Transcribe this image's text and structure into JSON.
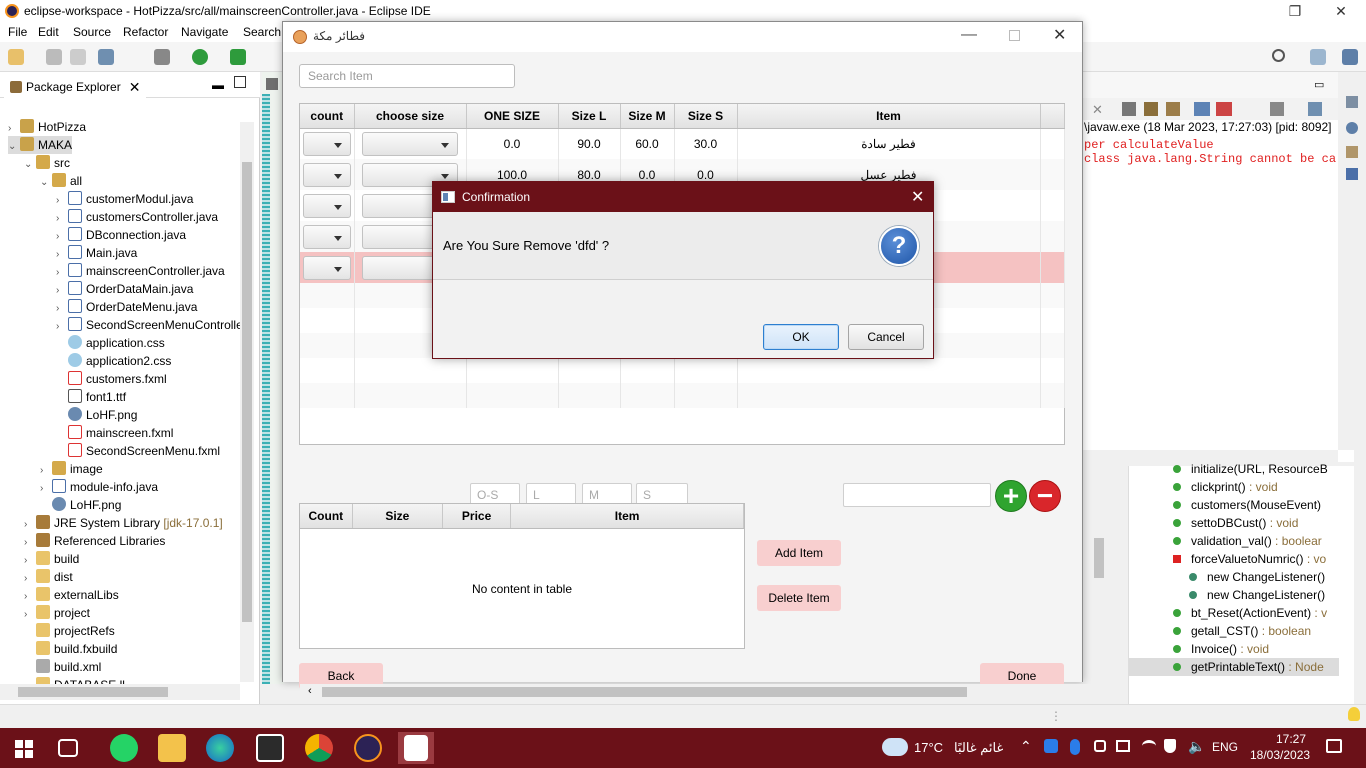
{
  "eclipse": {
    "title": "eclipse-workspace - HotPizza/src/all/mainscreenController.java - Eclipse IDE",
    "menu": [
      "File",
      "Edit",
      "Source",
      "Refactor",
      "Navigate",
      "Search"
    ],
    "package_explorer": {
      "tab": "Package Explorer",
      "items": [
        {
          "label": "HotPizza",
          "icon": "project-icon"
        },
        {
          "label": "MAKA",
          "icon": "project-icon"
        },
        {
          "label": "src",
          "icon": "package-folder-icon"
        },
        {
          "label": "all",
          "icon": "package-icon"
        },
        {
          "label": "customerModul.java",
          "icon": "java-file-icon"
        },
        {
          "label": "customersController.java",
          "icon": "java-file-icon"
        },
        {
          "label": "DBconnection.java",
          "icon": "java-file-icon"
        },
        {
          "label": "Main.java",
          "icon": "java-file-icon"
        },
        {
          "label": "mainscreenController.java",
          "icon": "java-file-icon"
        },
        {
          "label": "OrderDataMain.java",
          "icon": "java-file-icon"
        },
        {
          "label": "OrderDateMenu.java",
          "icon": "java-file-icon"
        },
        {
          "label": "SecondScreenMenuControlle",
          "icon": "java-file-icon"
        },
        {
          "label": "application.css",
          "icon": "css-file-icon"
        },
        {
          "label": "application2.css",
          "icon": "css-file-icon"
        },
        {
          "label": "customers.fxml",
          "icon": "fxml-file-icon"
        },
        {
          "label": "font1.ttf",
          "icon": "font-file-icon"
        },
        {
          "label": "LoHF.png",
          "icon": "image-file-icon"
        },
        {
          "label": "mainscreen.fxml",
          "icon": "fxml-file-icon"
        },
        {
          "label": "SecondScreenMenu.fxml",
          "icon": "fxml-file-icon"
        },
        {
          "label": "image",
          "icon": "package-icon"
        },
        {
          "label": "module-info.java",
          "icon": "java-file-icon"
        },
        {
          "label": "LoHF.png",
          "icon": "image-file-icon"
        },
        {
          "label": "JRE System Library",
          "suffix": "[jdk-17.0.1]",
          "icon": "library-icon"
        },
        {
          "label": "Referenced Libraries",
          "icon": "library-icon"
        },
        {
          "label": "build",
          "icon": "folder-icon"
        },
        {
          "label": "dist",
          "icon": "folder-icon"
        },
        {
          "label": "externalLibs",
          "icon": "folder-icon"
        },
        {
          "label": "project",
          "icon": "folder-icon"
        },
        {
          "label": "projectRefs",
          "icon": "folder-icon"
        },
        {
          "label": "build.fxbuild",
          "icon": "file-icon"
        },
        {
          "label": "build.xml",
          "icon": "xml-file-icon"
        },
        {
          "label": "DATABASE.ll",
          "icon": "file-icon"
        }
      ]
    },
    "console": {
      "header": "\\javaw.exe  (18 Mar 2023, 17:27:03) [pid: 8092]",
      "lines": [
        "per calculateValue",
        "class java.lang.String cannot be ca"
      ]
    },
    "outline": [
      {
        "label": "initialize(URL, ResourceB",
        "type": "",
        "kind": "method"
      },
      {
        "label": "clickprint()",
        "type": " : void",
        "kind": "method"
      },
      {
        "label": "customers(MouseEvent)",
        "type": "",
        "kind": "method"
      },
      {
        "label": "settoDBCust()",
        "type": " : void",
        "kind": "method"
      },
      {
        "label": "validation_val()",
        "type": " : boolear",
        "kind": "method"
      },
      {
        "label": "forceValuetoNumric()",
        "type": " : vo",
        "kind": "private"
      },
      {
        "label": "new ChangeListener()",
        "type": "",
        "kind": "anon"
      },
      {
        "label": "new ChangeListener()",
        "type": "",
        "kind": "anon"
      },
      {
        "label": "bt_Reset(ActionEvent)",
        "type": " : v",
        "kind": "method"
      },
      {
        "label": "getall_CST()",
        "type": " : boolean",
        "kind": "method"
      },
      {
        "label": "Invoice()",
        "type": " : void",
        "kind": "method"
      },
      {
        "label": "getPrintableText()",
        "type": " : Node",
        "kind": "method"
      }
    ]
  },
  "app": {
    "title": "فطائر مكة",
    "search_placeholder": "Search Item",
    "items_table": {
      "columns": [
        "count",
        "choose size",
        "ONE SIZE",
        "Size L",
        "Size M",
        "Size S",
        "Item"
      ],
      "rows": [
        {
          "one": "0.0",
          "l": "90.0",
          "m": "60.0",
          "s": "30.0",
          "item": "فطير سادة"
        },
        {
          "one": "100.0",
          "l": "80.0",
          "m": "0.0",
          "s": "0.0",
          "item": "فطير عسل"
        },
        {
          "one": "",
          "l": "",
          "m": "",
          "s": "",
          "item": ""
        },
        {
          "one": "",
          "l": "",
          "m": "",
          "s": "",
          "item": ""
        },
        {
          "one": "",
          "l": "",
          "m": "",
          "s": "",
          "item": ""
        }
      ]
    },
    "price_inputs": {
      "os": "O-S",
      "l": "L",
      "m": "M",
      "s": "S"
    },
    "add_symbol": "+",
    "remove_symbol": "−",
    "order_table": {
      "columns": [
        "Count",
        "Size",
        "Price",
        "Item"
      ],
      "empty": "No content in table"
    },
    "buttons": {
      "add_item": "Add  Item",
      "delete_item": "Delete Item",
      "back": "Back",
      "done": "Done"
    }
  },
  "dialog": {
    "title": "Confirmation",
    "message": "Are You Sure Remove 'dfd' ?",
    "icon": "?",
    "ok": "OK",
    "cancel": "Cancel"
  },
  "taskbar": {
    "weather_temp": "17°C",
    "weather_text": "غائم غالبًا",
    "language": "ENG",
    "time": "17:27",
    "date": "18/03/2023"
  },
  "colors": {
    "accent": "#6b1118",
    "pink_button": "#f8cfcf",
    "selected_row": "#f5c2c2",
    "add_green": "#2fa42f",
    "remove_red": "#d9262b"
  }
}
